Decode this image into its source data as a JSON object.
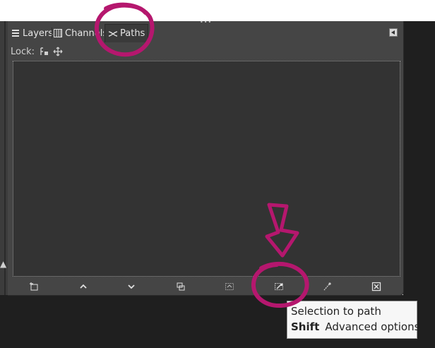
{
  "tabs": [
    {
      "label": "Layers",
      "icon": "layers-icon",
      "active": false
    },
    {
      "label": "Channels",
      "icon": "channels-icon",
      "active": false
    },
    {
      "label": "Paths",
      "icon": "paths-icon",
      "active": true
    }
  ],
  "lock": {
    "label": "Lock:",
    "icons": [
      "lock-position-icon",
      "lock-move-icon"
    ]
  },
  "bottom_toolbar": [
    {
      "name": "new-path-button",
      "icon": "new-path-icon"
    },
    {
      "name": "raise-path-button",
      "icon": "chevron-up-icon"
    },
    {
      "name": "lower-path-button",
      "icon": "chevron-down-icon"
    },
    {
      "name": "duplicate-path-button",
      "icon": "duplicate-icon"
    },
    {
      "name": "path-to-selection-button",
      "icon": "path-to-selection-icon"
    },
    {
      "name": "selection-to-path-button",
      "icon": "selection-to-path-icon"
    },
    {
      "name": "paint-along-path-button",
      "icon": "paint-path-icon"
    },
    {
      "name": "delete-path-button",
      "icon": "delete-icon"
    }
  ],
  "tooltip": {
    "line1": "Selection to path",
    "key": "Shift",
    "line2": "Advanced options"
  },
  "annotations": {
    "color": "#b5176e"
  },
  "colors": {
    "panel_bg": "#454545",
    "list_bg": "#333333",
    "desktop": "#1f1f1f"
  }
}
